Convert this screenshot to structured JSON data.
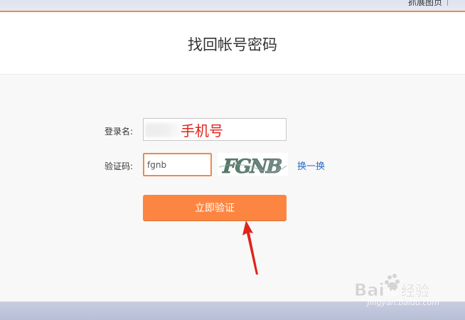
{
  "window": {
    "top_link_partial": "抓展图页"
  },
  "header": {
    "title": "找回帐号密码"
  },
  "form": {
    "login_label": "登录名:",
    "login_annotation": "手机号",
    "captcha_label": "验证码:",
    "captcha_value": "fgnb",
    "captcha_image_text": "FGNB",
    "refresh_label": "换一换",
    "submit_label": "立即验证"
  },
  "annotations": {
    "arrow_color": "#e0241a",
    "annotation_color": "#e0241a"
  },
  "colors": {
    "accent": "#fc8641",
    "link": "#2a6bc4"
  },
  "watermark": {
    "logo_text": "Bai",
    "logo_text2": "du",
    "logo_cn": "经验",
    "url": "jingyan.baidu.com"
  },
  "icons": {
    "arrow": "arrow-up-icon",
    "paw": "baidu-paw-icon"
  }
}
